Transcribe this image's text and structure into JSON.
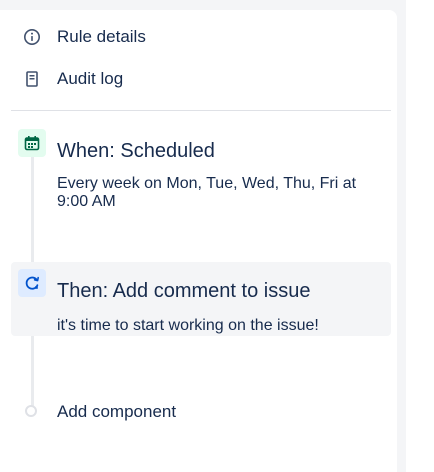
{
  "nav": {
    "rule_details": {
      "label": "Rule details",
      "icon": "info-icon"
    },
    "audit_log": {
      "label": "Audit log",
      "icon": "document-icon"
    }
  },
  "trigger": {
    "title": "When: Scheduled",
    "description": "Every week on Mon, Tue, Wed, Thu, Fri at 9:00 AM",
    "icon": "calendar-icon",
    "color": "#006644"
  },
  "action": {
    "title": "Then: Add comment to issue",
    "description": "it's time to start working on the issue!",
    "icon": "comment-refresh-icon",
    "color": "#0052cc"
  },
  "add_component": {
    "label": "Add component"
  }
}
